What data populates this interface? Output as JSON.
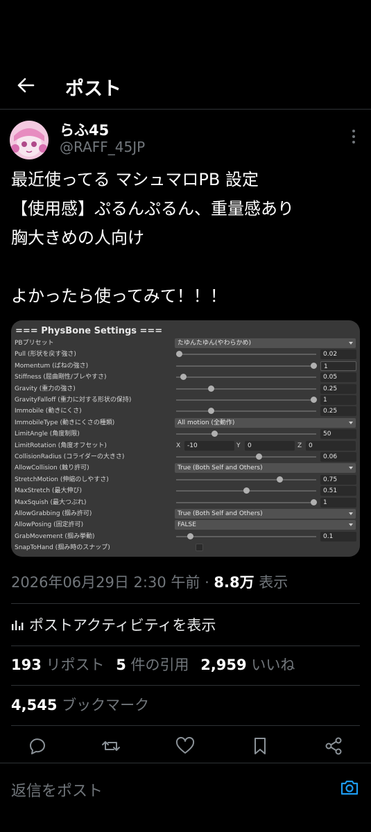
{
  "header": {
    "title": "ポスト"
  },
  "author": {
    "display_name": "らふ45",
    "handle": "@RAFF_45JP"
  },
  "tweet": {
    "lines": [
      "最近使ってる マシュマロPB 設定",
      "【使用感】ぷるんぷるん、重量感あり",
      "胸大きめの人向け",
      "",
      "よかったら使ってみて！！！"
    ]
  },
  "physbone": {
    "title": "=== PhysBone Settings ===",
    "rows": [
      {
        "label": "PBプリセット",
        "type": "dropdown",
        "value": "たゆんたゆん(やわらかめ)"
      },
      {
        "label": "Pull (形状を戻す強さ)",
        "type": "slider",
        "value": "0.02",
        "fraction": 0.02
      },
      {
        "label": "Momentum (ばねの強さ)",
        "type": "slider",
        "value": "1",
        "fraction": 1.0,
        "active": true
      },
      {
        "label": "Stiffness (屈曲剛性/ブレやすさ)",
        "type": "slider",
        "value": "0.05",
        "fraction": 0.05
      },
      {
        "label": "Gravity (重力の強さ)",
        "type": "slider",
        "value": "0.25",
        "fraction": 0.25
      },
      {
        "label": "GravityFalloff (重力に対する形状の保持)",
        "type": "slider",
        "value": "1",
        "fraction": 1.0
      },
      {
        "label": "Immobile (動きにくさ)",
        "type": "slider",
        "value": "0.25",
        "fraction": 0.25
      },
      {
        "label": "ImmobileType (動きにくさの種類)",
        "type": "dropdown",
        "value": "All motion (全動作)"
      },
      {
        "label": "LimitAngle (角度制限)",
        "type": "slider",
        "value": "50",
        "fraction": 0.28
      },
      {
        "label": "LimitRotation (角度オフセット)",
        "type": "vector",
        "x": "-10",
        "y": "0",
        "z": "0",
        "x_label": "X",
        "y_label": "Y",
        "z_label": "Z"
      },
      {
        "label": "CollisionRadius (コライダーの大きさ)",
        "type": "slider",
        "value": "0.06",
        "fraction": 0.6
      },
      {
        "label": "AllowCollision (触り許可)",
        "type": "dropdown",
        "value": "True (Both Self and Others)"
      },
      {
        "label": "StretchMotion (伸縮のしやすさ)",
        "type": "slider",
        "value": "0.75",
        "fraction": 0.75
      },
      {
        "label": "MaxStretch (最大伸び)",
        "type": "slider",
        "value": "0.51",
        "fraction": 0.51
      },
      {
        "label": "MaxSquish (最大つぶれ)",
        "type": "slider",
        "value": "1",
        "fraction": 1.0
      },
      {
        "label": "AllowGrabbing (掴み許可)",
        "type": "dropdown",
        "value": "True (Both Self and Others)"
      },
      {
        "label": "AllowPosing (固定許可)",
        "type": "dropdown",
        "value": "FALSE"
      },
      {
        "label": "GrabMovement (掴み挙動)",
        "type": "slider",
        "value": "0.1",
        "fraction": 0.1
      },
      {
        "label": "SnapToHand (掴み時のスナップ)",
        "type": "checkbox",
        "checked": false
      }
    ]
  },
  "meta": {
    "timestamp": "2026年06月29日 2:30 午前 · ",
    "views_count": "8.8万",
    "views_label": " 表示"
  },
  "activity_label": "ポストアクティビティを表示",
  "stats": {
    "reposts_count": "193",
    "reposts_label": "リポスト",
    "quotes_count": "5",
    "quotes_label": "件の引用",
    "likes_count": "2,959",
    "likes_label": "いいね"
  },
  "bookmarks": {
    "count": "4,545",
    "label": "ブックマーク"
  },
  "reply": {
    "placeholder": "返信をポスト"
  },
  "colors": {
    "background": "#000000",
    "muted": "#71767b",
    "accent": "#1d9bf0",
    "divider": "#2f3336"
  }
}
